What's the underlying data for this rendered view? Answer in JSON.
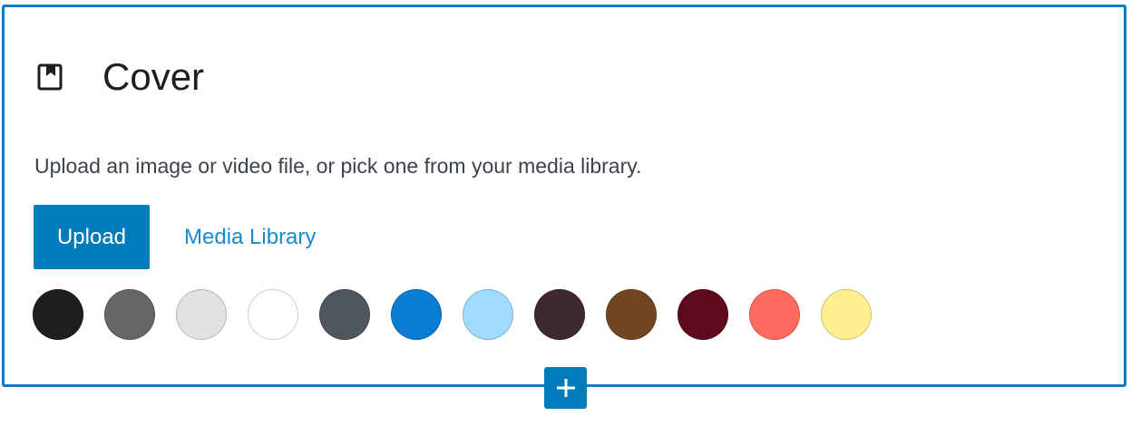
{
  "block": {
    "title": "Cover",
    "icon": "cover-block-icon",
    "instructions": "Upload an image or video file, or pick one from your media library.",
    "upload_label": "Upload",
    "media_library_label": "Media Library",
    "accent_color": "#007cba"
  },
  "swatches": [
    {
      "name": "black",
      "color": "#1e1e1e"
    },
    {
      "name": "dark-gray",
      "color": "#666666"
    },
    {
      "name": "light-gray",
      "color": "#e2e2e2"
    },
    {
      "name": "white",
      "color": "#ffffff"
    },
    {
      "name": "slate",
      "color": "#50565e"
    },
    {
      "name": "blue",
      "color": "#0a7cd4"
    },
    {
      "name": "light-blue",
      "color": "#a0dcff"
    },
    {
      "name": "dark-brown",
      "color": "#3e2a2e"
    },
    {
      "name": "brown",
      "color": "#714721"
    },
    {
      "name": "maroon",
      "color": "#5d0a1e"
    },
    {
      "name": "coral",
      "color": "#ff6b5f"
    },
    {
      "name": "pale-yellow",
      "color": "#ffef91"
    }
  ],
  "inserter": {
    "icon": "plus-icon"
  }
}
